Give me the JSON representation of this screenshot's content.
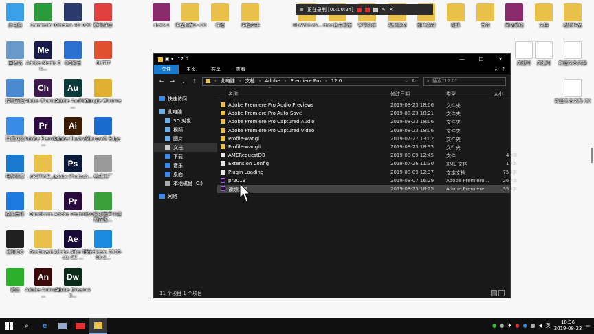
{
  "desktop": {
    "left_icons": [
      {
        "label": "此电脑",
        "icon": "computer-icon",
        "color": "#3aa0e8"
      },
      {
        "label": "Camtasia 9",
        "icon": "camtasia-icon",
        "color": "#2a9a3a"
      },
      {
        "label": "Cinema 4D R20",
        "icon": "cinema4d-icon",
        "color": "#2a3a6a"
      },
      {
        "label": "腾讯课堂",
        "icon": "tencent-class-icon",
        "color": "#e04040"
      },
      {
        "label": "回收站",
        "icon": "recycle-bin-icon",
        "color": "#6a9acb"
      },
      {
        "label": "Adobe Media En...",
        "icon": "adobe-me-icon",
        "color": "#1a1a4a",
        "text": "Me"
      },
      {
        "label": "QQ影音",
        "icon": "qq-player-icon",
        "color": "#2a70d0"
      },
      {
        "label": "8UFTP",
        "icon": "ftp-icon",
        "color": "#e05030"
      },
      {
        "label": "控制面板",
        "icon": "control-panel-icon",
        "color": "#4a8ad0"
      },
      {
        "label": "Adobe Charact...",
        "icon": "adobe-ch-icon",
        "color": "#3a1a4a",
        "text": "Ch"
      },
      {
        "label": "Adobe Audition ...",
        "icon": "adobe-au-icon",
        "color": "#0a3a3a",
        "text": "Au"
      },
      {
        "label": "Google Chrome",
        "icon": "chrome-icon",
        "color": "#e0b030"
      },
      {
        "label": "百度网盘",
        "icon": "baidu-pan-icon",
        "color": "#3a8ae8"
      },
      {
        "label": "Adobe Premiere ...",
        "icon": "adobe-pr-icon",
        "color": "#2a0a3f",
        "text": "Pr"
      },
      {
        "label": "Adobe Illustrat...",
        "icon": "adobe-ai-icon",
        "color": "#3a1a00",
        "text": "Ai"
      },
      {
        "label": "Microsoft Edge",
        "icon": "edge-icon",
        "color": "#1a6ad0"
      },
      {
        "label": "电脑管家",
        "icon": "pc-manager-icon",
        "color": "#1a7ad0"
      },
      {
        "label": "ARCTIME_...",
        "icon": "folder-icon",
        "color": "#e8c04a"
      },
      {
        "label": "Adobe Photosh...",
        "icon": "adobe-ps-icon",
        "color": "#0a1a3a",
        "text": "Ps"
      },
      {
        "label": "格式工厂",
        "icon": "format-factory-icon",
        "color": "#9a9a9a"
      },
      {
        "label": "酷狗音乐",
        "icon": "kugou-icon",
        "color": "#1a7ae0"
      },
      {
        "label": "Bandicam...",
        "icon": "folder-icon",
        "color": "#e8c04a"
      },
      {
        "label": "Adobe Premie...",
        "icon": "adobe-pr-icon",
        "color": "#2a0a3f",
        "text": "Pr"
      },
      {
        "label": "KSS喜听思声卡控制面板...",
        "icon": "kss-icon",
        "color": "#3aa03a"
      },
      {
        "label": "腾讯QQ",
        "icon": "qq-icon",
        "color": "#202020"
      },
      {
        "label": "PanDownl...",
        "icon": "folder-icon",
        "color": "#e8c04a"
      },
      {
        "label": "Adobe After Effects CC ...",
        "icon": "adobe-ae-icon",
        "color": "#1a0a3a",
        "text": "Ae"
      },
      {
        "label": "bandicam 2019-08-2...",
        "icon": "video-file-icon",
        "color": "#1a8ae0"
      },
      {
        "label": "微信",
        "icon": "wechat-icon",
        "color": "#2ab02a"
      },
      {
        "label": "Adobe Animate ...",
        "icon": "adobe-an-icon",
        "color": "#3a0a0a",
        "text": "An"
      },
      {
        "label": "Adobe Dreamwe...",
        "icon": "adobe-dw-icon",
        "color": "#0a2a1a",
        "text": "Dw"
      }
    ],
    "top_icons": [
      {
        "label": "dux5.1",
        "icon": "winrar-icon",
        "color": "#8a2a6a"
      },
      {
        "label": "课程封面1~20",
        "icon": "folder-icon",
        "color": "#e8c04a"
      },
      {
        "label": "课程",
        "icon": "folder-icon",
        "color": "#e8c04a"
      },
      {
        "label": "课程安排",
        "icon": "folder-icon",
        "color": "#e8c04a"
      },
      {
        "label": "HDWiki-v6...",
        "icon": "folder-icon",
        "color": "#e8c04a"
      },
      {
        "label": "mac官方正版",
        "icon": "folder-icon",
        "color": "#e8c04a"
      },
      {
        "label": "字幕演示",
        "icon": "folder-icon",
        "color": "#e8c04a"
      },
      {
        "label": "视频素材",
        "icon": "folder-icon",
        "color": "#e8c04a"
      },
      {
        "label": "图片素材",
        "icon": "folder-icon",
        "color": "#e8c04a"
      },
      {
        "label": "配乐",
        "icon": "folder-icon",
        "color": "#e8c04a"
      },
      {
        "label": "音效",
        "icon": "folder-icon",
        "color": "#e8c04a"
      },
      {
        "label": "网站系统",
        "icon": "winrar-icon",
        "color": "#8a2a6a"
      },
      {
        "label": "文档",
        "icon": "folder-icon",
        "color": "#e8c04a"
      },
      {
        "label": "视频作品",
        "icon": "folder-icon",
        "color": "#e8c04a"
      }
    ],
    "right_icons": [
      {
        "label": "关键词",
        "icon": "doc-icon",
        "color": "#ffffff"
      },
      {
        "label": "关键词",
        "icon": "doc-icon",
        "color": "#ffffff"
      },
      {
        "label": "新建文本文档",
        "icon": "doc-icon",
        "color": "#ffffff"
      },
      {
        "label": "新建文本文档 (2)",
        "icon": "doc-icon",
        "color": "#ffffff"
      }
    ]
  },
  "recorder": {
    "status": "正在录制 [00:00:24]"
  },
  "explorer": {
    "title": "12.0",
    "ribbon_tabs": [
      "文件",
      "主页",
      "共享",
      "查看"
    ],
    "address": {
      "crumbs": [
        "此电脑",
        "文档",
        "Adobe",
        "Premiere Pro",
        "12.0"
      ]
    },
    "search_placeholder": "搜索\"12.0\"",
    "nav": [
      {
        "label": "快速访问",
        "icon": "star-icon"
      },
      {
        "label": "此电脑",
        "icon": "computer-icon"
      },
      {
        "label": "3D 对象",
        "icon": "3d-objects-icon"
      },
      {
        "label": "视频",
        "icon": "video-icon"
      },
      {
        "label": "图片",
        "icon": "pictures-icon"
      },
      {
        "label": "文档",
        "icon": "documents-icon"
      },
      {
        "label": "下载",
        "icon": "download-icon"
      },
      {
        "label": "音乐",
        "icon": "music-icon"
      },
      {
        "label": "桌面",
        "icon": "desktop-icon"
      },
      {
        "label": "本地磁盘 (C:)",
        "icon": "drive-icon"
      },
      {
        "label": "网络",
        "icon": "network-icon"
      }
    ],
    "columns": {
      "name": "名称",
      "date": "修改日期",
      "type": "类型",
      "size": "大小"
    },
    "files": [
      {
        "name": "Adobe Premiere Pro Audio Previews",
        "date": "2019-08-23 18:06",
        "type": "文件夹",
        "size": "",
        "kind": "folder"
      },
      {
        "name": "Adobe Premiere Pro Auto-Save",
        "date": "2019-08-23 18:21",
        "type": "文件夹",
        "size": "",
        "kind": "folder"
      },
      {
        "name": "Adobe Premiere Pro Captured Audio",
        "date": "2019-08-23 18:06",
        "type": "文件夹",
        "size": "",
        "kind": "folder"
      },
      {
        "name": "Adobe Premiere Pro Captured Video",
        "date": "2019-08-23 18:06",
        "type": "文件夹",
        "size": "",
        "kind": "folder"
      },
      {
        "name": "Profile-wangl",
        "date": "2019-07-27 13:02",
        "type": "文件夹",
        "size": "",
        "kind": "folder"
      },
      {
        "name": "Profile-wangli",
        "date": "2019-08-23 18:35",
        "type": "文件夹",
        "size": "",
        "kind": "folder"
      },
      {
        "name": "AMERequestDB",
        "date": "2019-08-09 12:45",
        "type": "文件",
        "size": "4 KB",
        "kind": "file"
      },
      {
        "name": "Extension Config",
        "date": "2019-07-26 11:30",
        "type": "XML 文档",
        "size": "1 KB",
        "kind": "file"
      },
      {
        "name": "Plugin Loading",
        "date": "2019-08-09 12:37",
        "type": "文本文档",
        "size": "75 KB",
        "kind": "file"
      },
      {
        "name": "pr2019",
        "date": "2019-08-07 16:29",
        "type": "Adobe Premiere...",
        "size": "26 KB",
        "kind": "pr"
      },
      {
        "name": "视频演示",
        "date": "2019-08-23 18:25",
        "type": "Adobe Premiere...",
        "size": "35 KB",
        "kind": "pr",
        "selected": true
      }
    ],
    "status": "11 个项目  1 个项目"
  },
  "taskbar": {
    "time": "18:36",
    "date": "2019-08-23",
    "ime": "英"
  }
}
